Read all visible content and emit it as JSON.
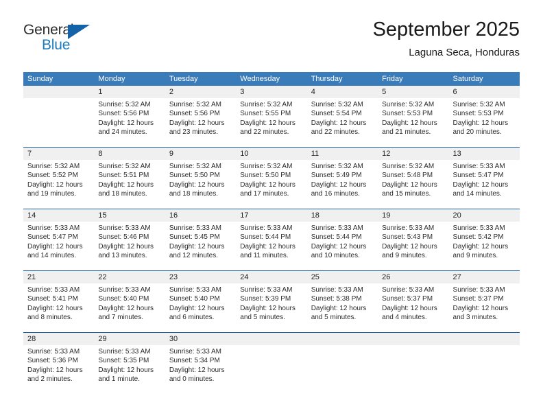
{
  "brand": {
    "name_part1": "General",
    "name_part2": "Blue",
    "icon": "flag-triangle-icon",
    "colors": {
      "text_dark": "#2b2b2b",
      "text_blue": "#1b7bbf",
      "flag_blue": "#1462a8"
    }
  },
  "header": {
    "title": "September 2025",
    "subtitle": "Laguna Seca, Honduras"
  },
  "theme": {
    "header_row_bg": "#3a7cba",
    "header_row_text": "#ffffff",
    "daynum_band_bg": "#f0f0f0",
    "week_divider": "#1f5f9e"
  },
  "weekdays": [
    "Sunday",
    "Monday",
    "Tuesday",
    "Wednesday",
    "Thursday",
    "Friday",
    "Saturday"
  ],
  "weeks": [
    {
      "days": [
        {
          "num": "",
          "lines": []
        },
        {
          "num": "1",
          "lines": [
            "Sunrise: 5:32 AM",
            "Sunset: 5:56 PM",
            "Daylight: 12 hours",
            "and 24 minutes."
          ]
        },
        {
          "num": "2",
          "lines": [
            "Sunrise: 5:32 AM",
            "Sunset: 5:56 PM",
            "Daylight: 12 hours",
            "and 23 minutes."
          ]
        },
        {
          "num": "3",
          "lines": [
            "Sunrise: 5:32 AM",
            "Sunset: 5:55 PM",
            "Daylight: 12 hours",
            "and 22 minutes."
          ]
        },
        {
          "num": "4",
          "lines": [
            "Sunrise: 5:32 AM",
            "Sunset: 5:54 PM",
            "Daylight: 12 hours",
            "and 22 minutes."
          ]
        },
        {
          "num": "5",
          "lines": [
            "Sunrise: 5:32 AM",
            "Sunset: 5:53 PM",
            "Daylight: 12 hours",
            "and 21 minutes."
          ]
        },
        {
          "num": "6",
          "lines": [
            "Sunrise: 5:32 AM",
            "Sunset: 5:53 PM",
            "Daylight: 12 hours",
            "and 20 minutes."
          ]
        }
      ]
    },
    {
      "days": [
        {
          "num": "7",
          "lines": [
            "Sunrise: 5:32 AM",
            "Sunset: 5:52 PM",
            "Daylight: 12 hours",
            "and 19 minutes."
          ]
        },
        {
          "num": "8",
          "lines": [
            "Sunrise: 5:32 AM",
            "Sunset: 5:51 PM",
            "Daylight: 12 hours",
            "and 18 minutes."
          ]
        },
        {
          "num": "9",
          "lines": [
            "Sunrise: 5:32 AM",
            "Sunset: 5:50 PM",
            "Daylight: 12 hours",
            "and 18 minutes."
          ]
        },
        {
          "num": "10",
          "lines": [
            "Sunrise: 5:32 AM",
            "Sunset: 5:50 PM",
            "Daylight: 12 hours",
            "and 17 minutes."
          ]
        },
        {
          "num": "11",
          "lines": [
            "Sunrise: 5:32 AM",
            "Sunset: 5:49 PM",
            "Daylight: 12 hours",
            "and 16 minutes."
          ]
        },
        {
          "num": "12",
          "lines": [
            "Sunrise: 5:32 AM",
            "Sunset: 5:48 PM",
            "Daylight: 12 hours",
            "and 15 minutes."
          ]
        },
        {
          "num": "13",
          "lines": [
            "Sunrise: 5:33 AM",
            "Sunset: 5:47 PM",
            "Daylight: 12 hours",
            "and 14 minutes."
          ]
        }
      ]
    },
    {
      "days": [
        {
          "num": "14",
          "lines": [
            "Sunrise: 5:33 AM",
            "Sunset: 5:47 PM",
            "Daylight: 12 hours",
            "and 14 minutes."
          ]
        },
        {
          "num": "15",
          "lines": [
            "Sunrise: 5:33 AM",
            "Sunset: 5:46 PM",
            "Daylight: 12 hours",
            "and 13 minutes."
          ]
        },
        {
          "num": "16",
          "lines": [
            "Sunrise: 5:33 AM",
            "Sunset: 5:45 PM",
            "Daylight: 12 hours",
            "and 12 minutes."
          ]
        },
        {
          "num": "17",
          "lines": [
            "Sunrise: 5:33 AM",
            "Sunset: 5:44 PM",
            "Daylight: 12 hours",
            "and 11 minutes."
          ]
        },
        {
          "num": "18",
          "lines": [
            "Sunrise: 5:33 AM",
            "Sunset: 5:44 PM",
            "Daylight: 12 hours",
            "and 10 minutes."
          ]
        },
        {
          "num": "19",
          "lines": [
            "Sunrise: 5:33 AM",
            "Sunset: 5:43 PM",
            "Daylight: 12 hours",
            "and 9 minutes."
          ]
        },
        {
          "num": "20",
          "lines": [
            "Sunrise: 5:33 AM",
            "Sunset: 5:42 PM",
            "Daylight: 12 hours",
            "and 9 minutes."
          ]
        }
      ]
    },
    {
      "days": [
        {
          "num": "21",
          "lines": [
            "Sunrise: 5:33 AM",
            "Sunset: 5:41 PM",
            "Daylight: 12 hours",
            "and 8 minutes."
          ]
        },
        {
          "num": "22",
          "lines": [
            "Sunrise: 5:33 AM",
            "Sunset: 5:40 PM",
            "Daylight: 12 hours",
            "and 7 minutes."
          ]
        },
        {
          "num": "23",
          "lines": [
            "Sunrise: 5:33 AM",
            "Sunset: 5:40 PM",
            "Daylight: 12 hours",
            "and 6 minutes."
          ]
        },
        {
          "num": "24",
          "lines": [
            "Sunrise: 5:33 AM",
            "Sunset: 5:39 PM",
            "Daylight: 12 hours",
            "and 5 minutes."
          ]
        },
        {
          "num": "25",
          "lines": [
            "Sunrise: 5:33 AM",
            "Sunset: 5:38 PM",
            "Daylight: 12 hours",
            "and 5 minutes."
          ]
        },
        {
          "num": "26",
          "lines": [
            "Sunrise: 5:33 AM",
            "Sunset: 5:37 PM",
            "Daylight: 12 hours",
            "and 4 minutes."
          ]
        },
        {
          "num": "27",
          "lines": [
            "Sunrise: 5:33 AM",
            "Sunset: 5:37 PM",
            "Daylight: 12 hours",
            "and 3 minutes."
          ]
        }
      ]
    },
    {
      "days": [
        {
          "num": "28",
          "lines": [
            "Sunrise: 5:33 AM",
            "Sunset: 5:36 PM",
            "Daylight: 12 hours",
            "and 2 minutes."
          ]
        },
        {
          "num": "29",
          "lines": [
            "Sunrise: 5:33 AM",
            "Sunset: 5:35 PM",
            "Daylight: 12 hours",
            "and 1 minute."
          ]
        },
        {
          "num": "30",
          "lines": [
            "Sunrise: 5:33 AM",
            "Sunset: 5:34 PM",
            "Daylight: 12 hours",
            "and 0 minutes."
          ]
        },
        {
          "num": "",
          "lines": []
        },
        {
          "num": "",
          "lines": []
        },
        {
          "num": "",
          "lines": []
        },
        {
          "num": "",
          "lines": []
        }
      ]
    }
  ]
}
